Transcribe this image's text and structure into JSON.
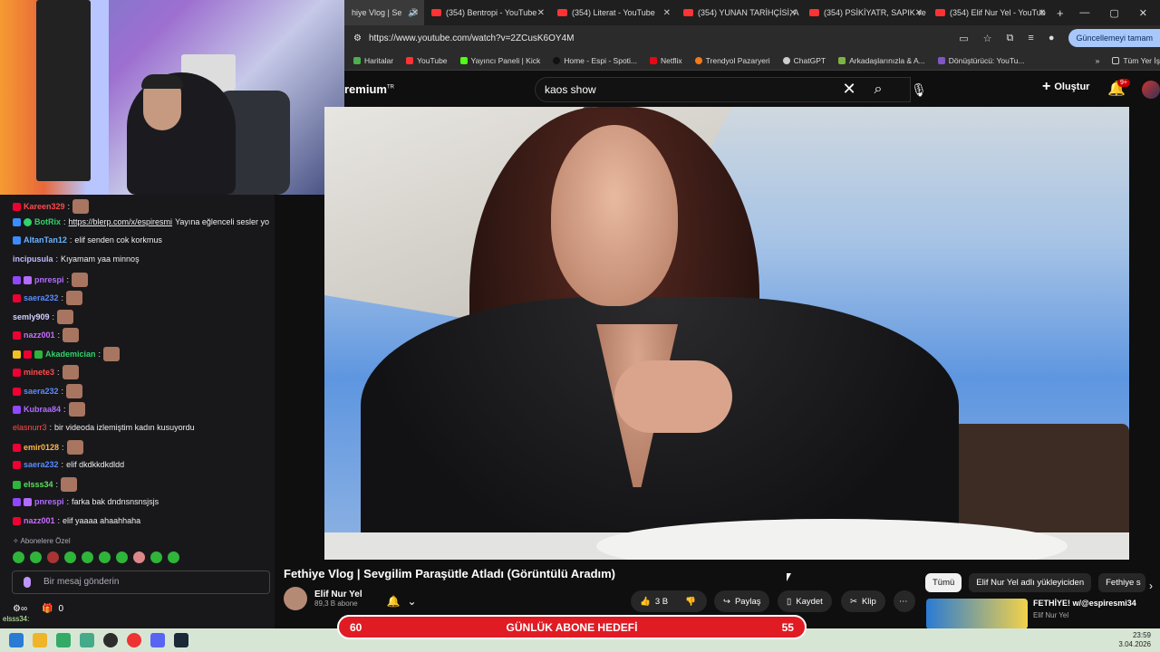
{
  "browser": {
    "tabs": [
      {
        "label": "hiye Vlog | Se",
        "active": true
      },
      {
        "label": "(354) Bentropi - YouTube"
      },
      {
        "label": "(354) Literat - YouTube"
      },
      {
        "label": "(354) YUNAN TARİHÇİSİ, A"
      },
      {
        "label": "(354) PSİKİYATR, SAPIK ve"
      },
      {
        "label": "(354) Elif Nur Yel - YouTub"
      }
    ],
    "url": "https://www.youtube.com/watch?v=2ZCusK6OY4M",
    "update_label": "Güncellemeyi tamam",
    "bookmarks": [
      "Haritalar",
      "YouTube",
      "Yayıncı Paneli | Kick",
      "Home - Espi - Spoti...",
      "Netflix",
      "Trendyol Pazaryeri",
      "ChatGPT",
      "Arkadaşlarınızla & A...",
      "Dönüştürücü: YouTu..."
    ],
    "all_bookmarks": "Tüm Yer İş"
  },
  "youtube": {
    "logo": "remium",
    "logo_sup": "TR",
    "search_value": "kaos show",
    "create_label": "Oluştur",
    "notif_count": "9+",
    "video_title": "Fethiye Vlog | Sevgilim Paraşütle Atladı (Görüntülü Aradım)",
    "channel_name": "Elif Nur Yel",
    "channel_subs": "89,3 B abone",
    "likes": "3 B",
    "share_label": "Paylaş",
    "save_label": "Kaydet",
    "clip_label": "Klip",
    "chips": [
      "Tümü",
      "Elif Nur Yel adlı yükleyiciden",
      "Fethiye s"
    ],
    "reco_title": "FETHİYE! w/@espiresmi34",
    "reco_channel": "Elif Nur Yel"
  },
  "chat": {
    "messages": [
      {
        "name": "Kareen329",
        "color": "#ff4a4a",
        "text": ""
      },
      {
        "name": "BotRix",
        "color": "#2fd46a",
        "link": "https://blerp.com/x/espiresmi",
        "text": " Yayına eğlenceli sesler yo"
      },
      {
        "name": "AltanTan12",
        "color": "#6ab5ff",
        "text": "elif senden cok korkmus"
      },
      {
        "name": "incipusula",
        "color": "#bbbbff",
        "text": "Kıyamam yaa minnoş"
      },
      {
        "name": "pnrespi",
        "color": "#b26cff",
        "text": ""
      },
      {
        "name": "saera232",
        "color": "#5a8bff",
        "text": ""
      },
      {
        "name": "semly909",
        "color": "#d0d0ff",
        "text": ""
      },
      {
        "name": "nazz001",
        "color": "#c86cff",
        "text": ""
      },
      {
        "name": "Akademician",
        "color": "#2fd46a",
        "text": ""
      },
      {
        "name": "minete3",
        "color": "#ff4a4a",
        "text": ""
      },
      {
        "name": "saera232",
        "color": "#5a8bff",
        "text": ""
      },
      {
        "name": "Kubraa84",
        "color": "#b26cff",
        "text": ""
      },
      {
        "name": "elasnurr3",
        "color": "#ff4a4a",
        "text": "bir videoda izlemiştim kadın kusuyordu"
      },
      {
        "name": "emir0128",
        "color": "#ffb74a",
        "text": ""
      },
      {
        "name": "saera232",
        "color": "#5a8bff",
        "text": "elif dkdkkdkdldd"
      },
      {
        "name": "elsss34",
        "color": "#5ae05a",
        "text": ""
      },
      {
        "name": "pnrespi",
        "color": "#b26cff",
        "text": "farka bak dndnsnsnsjsjs"
      },
      {
        "name": "nazz001",
        "color": "#c86cff",
        "text": "elif yaaaa ahaahhaha"
      }
    ],
    "subscribers_only": "Abonelere Özel",
    "input_placeholder": "Bir mesaj gönderin",
    "viewers": "0",
    "bottom_user": "elsss34:"
  },
  "goal": {
    "left": "60",
    "label": "GÜNLÜK ABONE HEDEFİ",
    "right": "55"
  },
  "clock": {
    "time": "23:59",
    "date": "3.04.2026"
  }
}
